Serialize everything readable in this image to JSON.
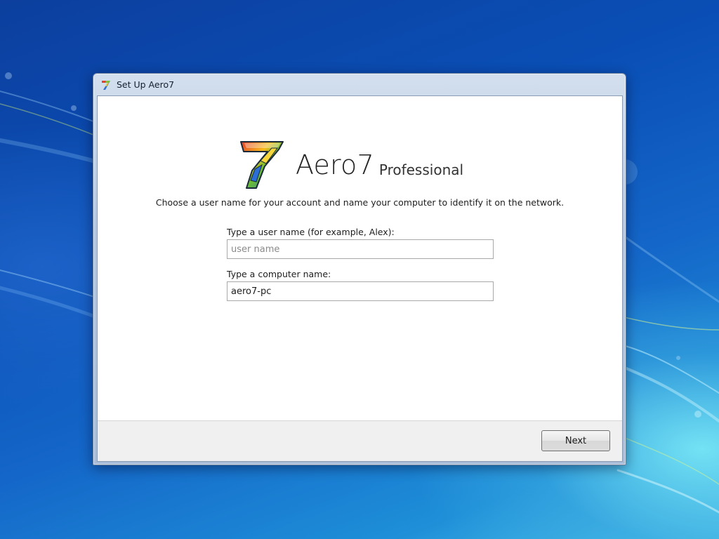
{
  "window": {
    "title": "Set Up Aero7",
    "icon": "aero7-logo-icon"
  },
  "header": {
    "logo_icon": "aero7-seven-logo",
    "product_name": "Aero7",
    "product_edition": "Professional"
  },
  "instruction": "Choose a user name for your account and name your computer to identify it on the network.",
  "form": {
    "username_label": "Type a user name (for example, Alex):",
    "username_value": "",
    "username_placeholder": "user name",
    "computer_label": "Type a computer name:",
    "computer_value": "aero7-pc",
    "computer_placeholder": ""
  },
  "footer": {
    "next_label": "Next"
  },
  "colors": {
    "desktop_blue": "#0a4fb6",
    "desktop_cyan": "#4cc2e8",
    "window_frame": "#b4c7df"
  }
}
